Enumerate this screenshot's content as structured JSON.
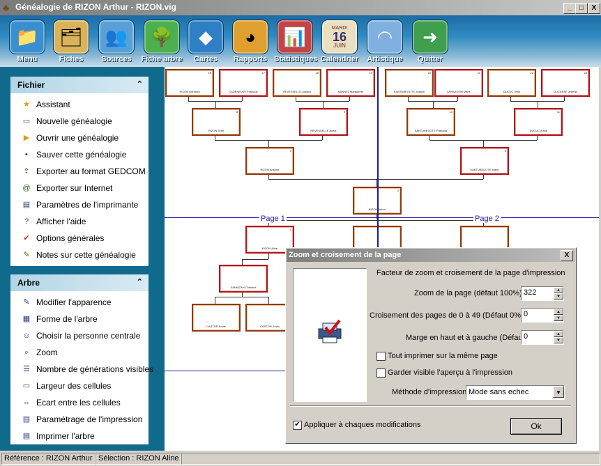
{
  "window": {
    "title": "Généalogie de RIZON Arthur - RIZON.vig",
    "controls": [
      "_",
      "□",
      "X"
    ]
  },
  "toolbar": [
    {
      "label": "Menu",
      "icon": "folder-icon",
      "color": "#3a8fd1"
    },
    {
      "label": "Fiches",
      "icon": "cards-icon",
      "color": "#d9b35a"
    },
    {
      "label": "Sources",
      "icon": "people-icon",
      "color": "#5aa0d8"
    },
    {
      "label": "Fiche arbre",
      "icon": "tree-card-icon",
      "color": "#4caf50"
    },
    {
      "label": "Cartes",
      "icon": "france-map-icon",
      "color": "#2f7fc4"
    },
    {
      "label": "Rapports",
      "icon": "pie-chart-icon",
      "color": "#e0a030"
    },
    {
      "label": "Statistiques",
      "icon": "bar-chart-icon",
      "color": "#c24444"
    },
    {
      "label": "Calendrier",
      "icon": "calendar-icon",
      "color": "#e8e0c0"
    },
    {
      "label": "Artistique",
      "icon": "artistic-fan-icon",
      "color": "#7fb0e0"
    },
    {
      "label": "Quitter",
      "icon": "exit-door-icon",
      "color": "#3f9f4f"
    }
  ],
  "calendar_icon": {
    "day": "MARDI",
    "date": "16",
    "month": "JUIN"
  },
  "sidebar": {
    "fichier": {
      "title": "Fichier",
      "items": [
        {
          "label": "Assistant",
          "icon": "star-icon"
        },
        {
          "label": "Nouvelle généalogie",
          "icon": "new-file-icon"
        },
        {
          "label": "Ouvrir une généalogie",
          "icon": "open-folder-icon"
        },
        {
          "label": "Sauver cette généalogie",
          "icon": "save-icon"
        },
        {
          "label": "Exporter au format GEDCOM",
          "icon": "export-icon"
        },
        {
          "label": "Exporter sur Internet",
          "icon": "internet-icon"
        },
        {
          "label": "Paramètres de l'imprimante",
          "icon": "printer-icon"
        },
        {
          "label": "Afficher l'aide",
          "icon": "help-icon"
        },
        {
          "label": "Options générales",
          "icon": "options-icon"
        },
        {
          "label": "Notes sur cette généalogie",
          "icon": "notes-icon"
        }
      ]
    },
    "arbre": {
      "title": "Arbre",
      "items": [
        {
          "label": "Modifier l'apparence",
          "icon": "appearance-icon"
        },
        {
          "label": "Forme de l'arbre",
          "icon": "tree-shape-icon"
        },
        {
          "label": "Choisir la personne centrale",
          "icon": "central-person-icon"
        },
        {
          "label": "Zoom",
          "icon": "zoom-icon"
        },
        {
          "label": "Nombre de générations visibles",
          "icon": "generations-icon"
        },
        {
          "label": "Largeur des cellules",
          "icon": "cell-width-icon"
        },
        {
          "label": "Ecart entre les cellules",
          "icon": "cell-spacing-icon"
        },
        {
          "label": "Paramétrage de l'impression",
          "icon": "print-setup-icon"
        },
        {
          "label": "Imprimer l'arbre",
          "icon": "print-tree-icon"
        }
      ]
    }
  },
  "tree": {
    "page_labels": [
      "Page 1",
      "Page 2"
    ],
    "cells": [
      {
        "name": "RIZON Germont",
        "num": "16",
        "style": "brown"
      },
      {
        "name": "CADENEUVE François",
        "num": "17",
        "style": "red"
      },
      {
        "name": "REVESSELLE Joseph",
        "num": "18",
        "style": "brown"
      },
      {
        "name": "BANNEL Marguerite",
        "num": "19",
        "style": "red"
      },
      {
        "name": "EABTUBEGOTE Joseph",
        "num": "20",
        "style": "brown"
      },
      {
        "name": "LANSASSIN Marie",
        "num": "21",
        "style": "red"
      },
      {
        "name": "DUCUC Jean",
        "num": "22",
        "style": "brown"
      },
      {
        "name": "DUCASSE Jeanne",
        "num": "23",
        "style": "red"
      },
      {
        "name": "RIZON Jean",
        "num": "8",
        "style": "brown"
      },
      {
        "name": "REVESSELLE Anaïs",
        "num": "9",
        "style": "red"
      },
      {
        "name": "EABTUBEGOTE François",
        "num": "10",
        "style": "brown"
      },
      {
        "name": "DUCUC Anna",
        "num": "11",
        "style": "red"
      },
      {
        "name": "RIZON Antoine",
        "num": "4",
        "style": "brown"
      },
      {
        "name": "EABTUBEGOTE Marie",
        "num": "5",
        "style": "red"
      },
      {
        "name": "RIZON Arthur",
        "num": "2",
        "style": "brown"
      },
      {
        "name": "RIZON Aline",
        "num": "1",
        "style": "red"
      },
      {
        "name": "",
        "num": "",
        "style": "brown"
      },
      {
        "name": "",
        "num": "",
        "style": "brown"
      },
      {
        "name": "SANNIZAN Christine",
        "num": "",
        "style": "red"
      },
      {
        "name": "CASTOR Emile",
        "num": "",
        "style": "brown"
      },
      {
        "name": "CASTOR Kevin",
        "num": "",
        "style": "brown"
      }
    ]
  },
  "dialog": {
    "title": "Zoom et croisement de la page",
    "heading": "Facteur de zoom  et croisement de la page d'impression",
    "zoom_label": "Zoom de la page (défaut 100%)",
    "zoom_value": "322",
    "overlap_label": "Croisement des pages de 0 à 49 (Défaut 0%)",
    "overlap_value": "0",
    "margin_label": "Marge en haut et à gauche (Défaut 0%)",
    "margin_value": "0",
    "print_all_label": "Tout imprimer sur la même page",
    "print_all_checked": false,
    "keep_preview_label": "Garder visible l'aperçu à l'impression",
    "keep_preview_checked": false,
    "method_label": "Méthode d'impression",
    "method_value": "Mode sans echec",
    "apply_label": "Appliquer à chaques modifications",
    "apply_checked": true,
    "ok_label": "Ok",
    "close_label": "X"
  },
  "status": {
    "reference": "Référence : RIZON Arthur",
    "selection": "Sélection : RIZON Aline"
  }
}
